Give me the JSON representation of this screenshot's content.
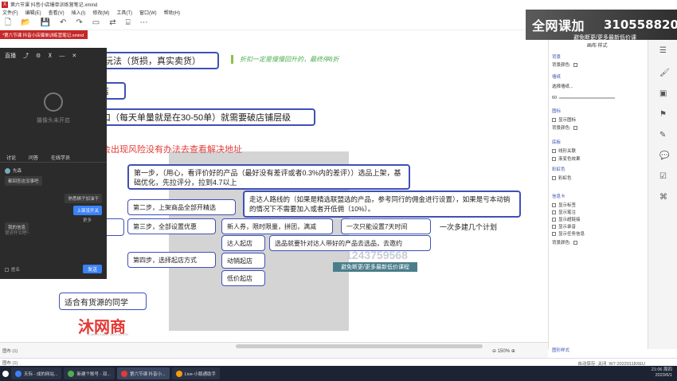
{
  "window": {
    "title": "第六节课 抖音小店爆单训练营笔记.xmind",
    "menu": [
      "文件(F)",
      "编辑(E)",
      "查看(V)",
      "插入(I)",
      "修改(M)",
      "工具(T)",
      "窗口(W)",
      "帮助(H)"
    ],
    "doc_tab": "*第六节课 抖音小店爆单训练营笔记.xmind"
  },
  "banner": {
    "main": "全网课加",
    "qq": "3105588203",
    "sub": "避免断更/更多最新低价课"
  },
  "live_panel": {
    "title": "直播",
    "camera_status": "摄像头未开启",
    "tabs": [
      "讨论",
      "问答",
      "在线学员"
    ],
    "messages": [
      {
        "user": "先森",
        "text": "都回答这没事吧"
      },
      {
        "user": "",
        "text": "熟悉狮子加油干"
      },
      {
        "user": "",
        "text": "上架没开关"
      },
      {
        "user": "",
        "text": "我的信息"
      }
    ],
    "input_placeholder": "说点什么吧~",
    "anon_label": "匿名",
    "send_label": "发送",
    "more_label": "更多"
  },
  "mindmap": {
    "node_gameplay": "的玩法（货损，真实卖货）",
    "green_note": "折扣一定是慢慢回升的，最终停8折",
    "node_shop": "店",
    "node_entry": "口（每天单量就是在30-50单）就需要破店铺层级",
    "red_heading": "会出现风险没有办法去查看解决地址",
    "step1": "第一步，（用心，看评价好的产品（最好没有差评或者0.3%内的差评））选品上架，基础优化，先拉评分，拉到4.7以上",
    "step2": "第二步，上架商品全部开精选",
    "step2_detail": "走达人路线的（如果是精选联盟选的产品，参考同行的佣金进行设置），如果是亏本动销的情况下不需要加入或者开低佣（10%）。",
    "step3": "第三步，全部设置优惠",
    "coupon": "新人券，限时限量，拼团，满减",
    "once": "一次只能设置7天时间",
    "node_product": "品",
    "weekly": "一次多建几个计划",
    "influencer": "达人起店",
    "influencer_detail": "选品就要针对达人带好的产品去选品，去邀约",
    "step4": "第四步，选择起店方式",
    "promo_start": "动销起店",
    "lowprice_start": "低价起店",
    "suitable": "适合有货源的同学",
    "watermark_logo": "沐网商",
    "watermark_sub": "E-MERCHANT EDUCATION",
    "watermark_phone": "1243759568",
    "watermark_btn": "避免断更/更多最新低价课程"
  },
  "format_panel": {
    "title": "画布 样式",
    "sections": [
      "背景",
      "墙纸",
      "图标",
      "底板",
      "彩虹色",
      "信息卡"
    ],
    "bg_color_label": "背景颜色:",
    "wallpaper_select": "选择墙纸...",
    "wallpaper_value": "60",
    "icon_opts": [
      "显示图标",
      "背景颜色:"
    ],
    "floor_opts": [
      "线形关联",
      "渐变色效果"
    ],
    "rainbow_opts": [
      "彩虹色"
    ],
    "card_opts": [
      "显示标签",
      "显示笔注",
      "显示超链接",
      "显示录音",
      "显示任务信息",
      "背景颜色:"
    ],
    "footer": "图形样式"
  },
  "status": {
    "canvas_label": "图布 (1)",
    "zoom": "150%",
    "sheet_tab": "图布 (1)",
    "autosave": "自动保存: 关闭",
    "user": "W7-20220118XEU"
  },
  "taskbar": {
    "items": [
      "天际 - 成的网站...",
      "新建个账号 - 双...",
      "第六节课 抖音小...",
      "Live-小鹅通助手"
    ],
    "time": "21:06 周四",
    "date": "2023/6/1"
  }
}
